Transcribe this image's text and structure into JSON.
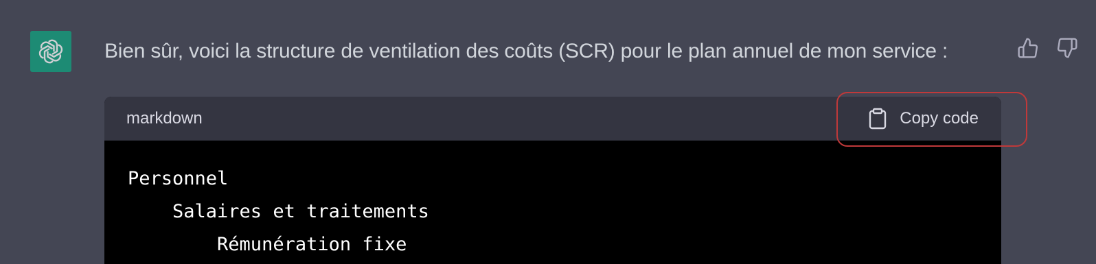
{
  "message": {
    "text": "Bien sûr, voici la structure de ventilation des coûts (SCR) pour le plan annuel de mon service :"
  },
  "feedback": {
    "thumbs_up_icon": "thumbs-up-icon",
    "thumbs_down_icon": "thumbs-down-icon"
  },
  "code_block": {
    "language": "markdown",
    "copy_label": "Copy code",
    "lines": [
      "Personnel",
      "    Salaires et traitements",
      "        Rémunération fixe"
    ]
  },
  "colors": {
    "background": "#444654",
    "code_header": "#343541",
    "code_body": "#000000",
    "avatar": "#10a37f",
    "highlight": "#c0393a"
  }
}
